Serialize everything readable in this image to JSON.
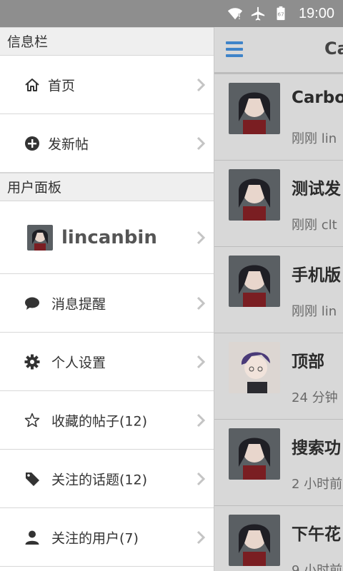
{
  "status_bar": {
    "time": "19:00",
    "battery_level": "67",
    "icons": [
      "wifi-icon",
      "airplane-icon",
      "battery-icon"
    ]
  },
  "drawer": {
    "section_info": "信息栏",
    "home_label": "首页",
    "new_post_label": "发新帖",
    "section_user": "用户面板",
    "username": "lincanbin",
    "messages_label": "消息提醒",
    "settings_label": "个人设置",
    "favorites_label": "收藏的帖子(12)",
    "tags_label": "关注的话题(12)",
    "following_label": "关注的用户(7)"
  },
  "main": {
    "title": "Ca",
    "topics": [
      {
        "title": "Carbo",
        "meta": "刚刚  lin"
      },
      {
        "title": "测试发",
        "meta": "刚刚  clt"
      },
      {
        "title": "手机版",
        "meta": "刚刚  lin"
      },
      {
        "title": "顶部",
        "meta": "24 分钟"
      },
      {
        "title": "搜索功",
        "meta": "2 小时前"
      },
      {
        "title": "下午花",
        "meta": "9 小时前"
      }
    ]
  },
  "colors": {
    "accent": "#3f84c9",
    "status_bar": "#8e8e8e",
    "drawer_bg": "#ffffff",
    "section_bg": "#efefef"
  }
}
